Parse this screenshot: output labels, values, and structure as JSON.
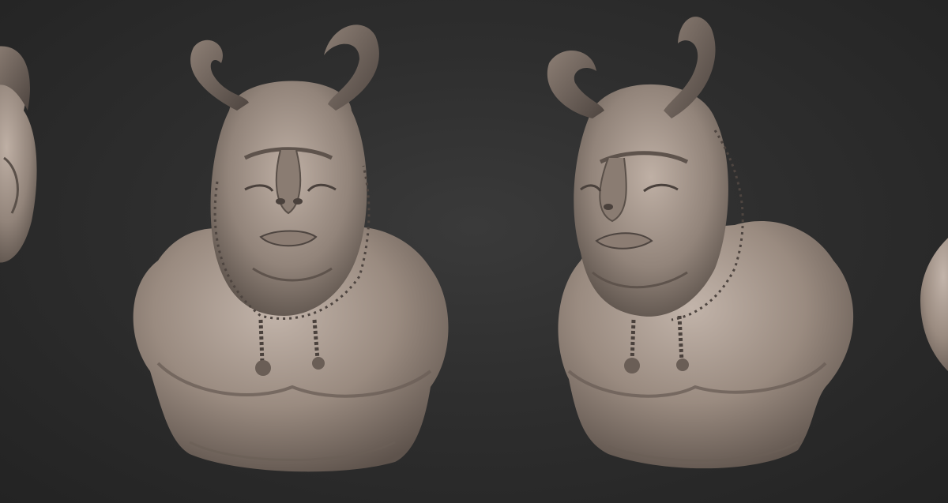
{
  "scene": {
    "background": "#2e2e2e",
    "material_color": "#9a8b80",
    "material_shadow": "#5e534c",
    "material_highlight": "#c2b4aa",
    "subjects": [
      {
        "view": "side-partial-left",
        "icon": "sculpt-bust-icon"
      },
      {
        "view": "front",
        "icon": "sculpt-bust-icon"
      },
      {
        "view": "three-quarter",
        "icon": "sculpt-bust-icon"
      },
      {
        "view": "side-partial-right",
        "icon": "sculpt-bust-icon"
      }
    ]
  }
}
